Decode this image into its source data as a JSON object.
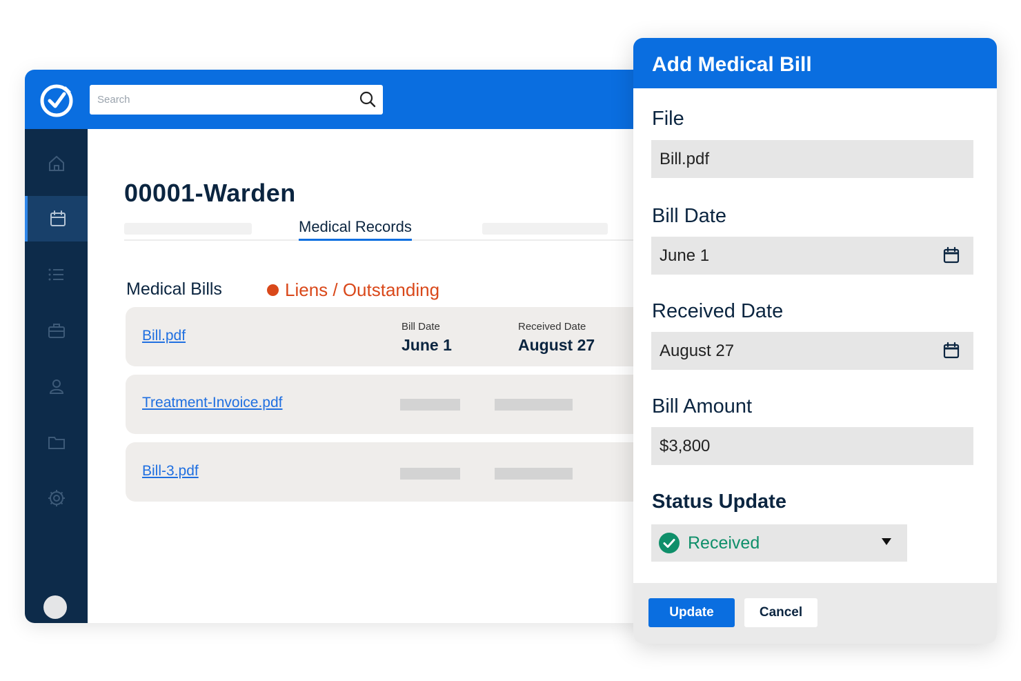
{
  "search": {
    "placeholder": "Search"
  },
  "sidebar": {
    "items": [
      {
        "name": "home"
      },
      {
        "name": "calendar",
        "active": true
      },
      {
        "name": "list"
      },
      {
        "name": "briefcase"
      },
      {
        "name": "user"
      },
      {
        "name": "folder"
      },
      {
        "name": "settings"
      }
    ]
  },
  "case": {
    "title": "00001-Warden",
    "active_tab": "Medical Records"
  },
  "bills_section": {
    "label": "Medical Bills",
    "status_filter": "Liens / Outstanding",
    "status_color": "#d9481a",
    "rows": [
      {
        "file": "Bill.pdf",
        "bill_date_label": "Bill Date",
        "bill_date": "June 1",
        "received_date_label": "Received Date",
        "received_date": "August 27"
      },
      {
        "file": "Treatment-Invoice.pdf"
      },
      {
        "file": "Bill-3.pdf"
      }
    ]
  },
  "modal": {
    "title": "Add Medical Bill",
    "file_label": "File",
    "file_value": "Bill.pdf",
    "bill_date_label": "Bill Date",
    "bill_date_value": "June 1",
    "received_date_label": "Received Date",
    "received_date_value": "August 27",
    "amount_label": "Bill Amount",
    "amount_value": "$3,800",
    "status_label": "Status Update",
    "status_value": "Received",
    "status_color": "#0f8f6a",
    "update_label": "Update",
    "cancel_label": "Cancel"
  },
  "colors": {
    "brand_blue": "#0a6ee0",
    "sidebar_navy": "#0d2b4a",
    "link_blue": "#1f6fe0"
  }
}
